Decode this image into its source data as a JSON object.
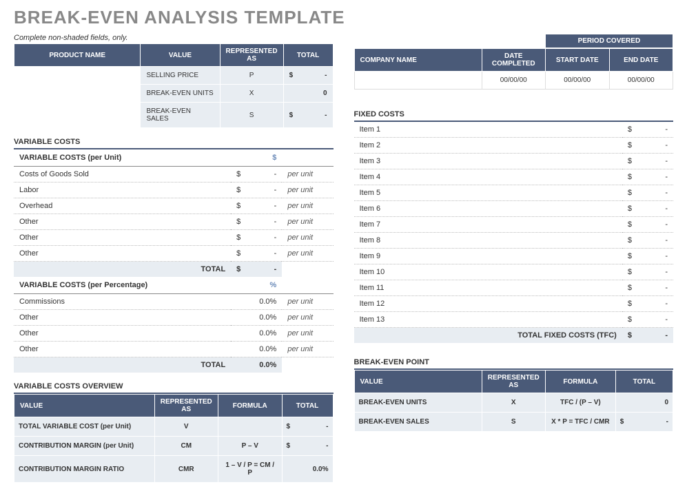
{
  "title": "BREAK-EVEN ANALYSIS TEMPLATE",
  "instruction": "Complete non-shaded fields, only.",
  "period_covered_label": "PERIOD   COVERED",
  "product_table": {
    "headers": {
      "product": "PRODUCT NAME",
      "value": "VALUE",
      "rep": "REPRESENTED AS",
      "total": "TOTAL"
    },
    "rows": [
      {
        "label": "SELLING PRICE",
        "rep": "P",
        "total_sym": "$",
        "total_val": "-"
      },
      {
        "label": "BREAK-EVEN UNITS",
        "rep": "X",
        "total_sym": "",
        "total_val": "0"
      },
      {
        "label": "BREAK-EVEN SALES",
        "rep": "S",
        "total_sym": "$",
        "total_val": "-"
      }
    ]
  },
  "company_table": {
    "headers": {
      "name": "COMPANY NAME",
      "completed": "DATE COMPLETED",
      "start": "START DATE",
      "end": "END DATE"
    },
    "values": {
      "completed": "00/00/00",
      "start": "00/00/00",
      "end": "00/00/00"
    }
  },
  "variable_costs": {
    "title": "VARIABLE COSTS",
    "unit_header": "VARIABLE COSTS (per Unit)",
    "unit_symbol": "$",
    "unit_rows": [
      {
        "label": "Costs of Goods Sold",
        "sym": "$",
        "val": "-",
        "unit": "per unit"
      },
      {
        "label": "Labor",
        "sym": "$",
        "val": "-",
        "unit": "per unit"
      },
      {
        "label": "Overhead",
        "sym": "$",
        "val": "-",
        "unit": "per unit"
      },
      {
        "label": "Other",
        "sym": "$",
        "val": "-",
        "unit": "per unit"
      },
      {
        "label": "Other",
        "sym": "$",
        "val": "-",
        "unit": "per unit"
      },
      {
        "label": "Other",
        "sym": "$",
        "val": "-",
        "unit": "per unit"
      }
    ],
    "unit_total_label": "TOTAL",
    "unit_total_sym": "$",
    "unit_total_val": "-",
    "pct_header": "VARIABLE COSTS (per Percentage)",
    "pct_symbol": "%",
    "pct_rows": [
      {
        "label": "Commissions",
        "val": "0.0%",
        "unit": "per unit"
      },
      {
        "label": "Other",
        "val": "0.0%",
        "unit": "per unit"
      },
      {
        "label": "Other",
        "val": "0.0%",
        "unit": "per unit"
      },
      {
        "label": "Other",
        "val": "0.0%",
        "unit": "per unit"
      }
    ],
    "pct_total_label": "TOTAL",
    "pct_total_val": "0.0%"
  },
  "fixed_costs": {
    "title": "FIXED COSTS",
    "rows": [
      {
        "label": "Item 1",
        "sym": "$",
        "val": "-"
      },
      {
        "label": "Item 2",
        "sym": "$",
        "val": "-"
      },
      {
        "label": "Item 3",
        "sym": "$",
        "val": "-"
      },
      {
        "label": "Item 4",
        "sym": "$",
        "val": "-"
      },
      {
        "label": "Item 5",
        "sym": "$",
        "val": "-"
      },
      {
        "label": "Item 6",
        "sym": "$",
        "val": "-"
      },
      {
        "label": "Item 7",
        "sym": "$",
        "val": "-"
      },
      {
        "label": "Item 8",
        "sym": "$",
        "val": "-"
      },
      {
        "label": "Item 9",
        "sym": "$",
        "val": "-"
      },
      {
        "label": "Item 10",
        "sym": "$",
        "val": "-"
      },
      {
        "label": "Item 11",
        "sym": "$",
        "val": "-"
      },
      {
        "label": "Item 12",
        "sym": "$",
        "val": "-"
      },
      {
        "label": "Item 13",
        "sym": "$",
        "val": "-"
      }
    ],
    "total_label": "TOTAL FIXED COSTS (TFC)",
    "total_sym": "$",
    "total_val": "-"
  },
  "overview": {
    "title": "VARIABLE COSTS OVERVIEW",
    "headers": {
      "value": "VALUE",
      "rep": "REPRESENTED AS",
      "formula": "FORMULA",
      "total": "TOTAL"
    },
    "rows": [
      {
        "label": "TOTAL VARIABLE COST (per Unit)",
        "rep": "V",
        "formula": "",
        "sym": "$",
        "val": "-"
      },
      {
        "label": "CONTRIBUTION MARGIN (per Unit)",
        "rep": "CM",
        "formula": "P – V",
        "sym": "$",
        "val": "-"
      },
      {
        "label": "CONTRIBUTION MARGIN RATIO",
        "rep": "CMR",
        "formula": "1 – V / P = CM / P",
        "sym": "",
        "val": "0.0%"
      }
    ]
  },
  "breakeven": {
    "title": "BREAK-EVEN POINT",
    "headers": {
      "value": "VALUE",
      "rep": "REPRESENTED AS",
      "formula": "FORMULA",
      "total": "TOTAL"
    },
    "rows": [
      {
        "label": "BREAK-EVEN UNITS",
        "rep": "X",
        "formula": "TFC / (P – V)",
        "sym": "",
        "val": "0"
      },
      {
        "label": "BREAK-EVEN SALES",
        "rep": "S",
        "formula": "X * P = TFC / CMR",
        "sym": "$",
        "val": "-"
      }
    ]
  }
}
